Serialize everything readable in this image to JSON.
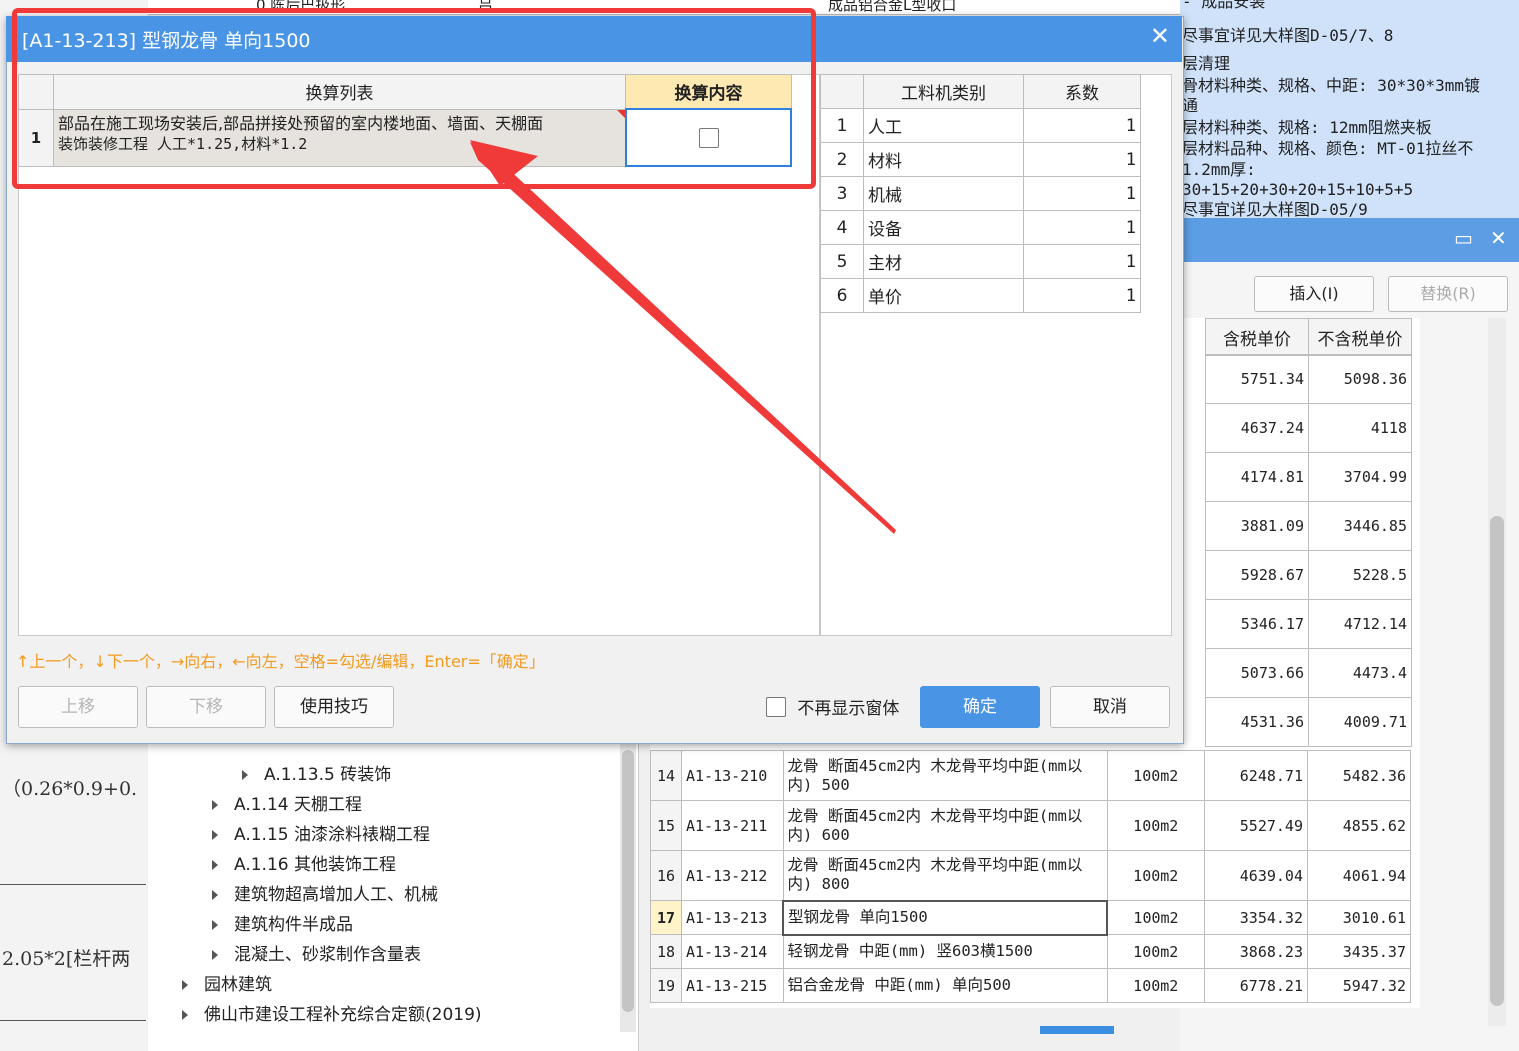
{
  "background": {
    "left_fragments": [
      "（0.26*0.9+0.",
      "2.05*2[栏杆两"
    ],
    "top_strip": [
      "成品铝合金L型收口",
      "吕",
      "0 陈后巴扱形"
    ],
    "description_lines": [
      "- 成品安装",
      "尽事宜详见大样图D-05/7、8",
      "层清理",
      "骨材料种类、规格、中距: 30*30*3mm镀",
      "通",
      "层材料种类、规格: 12mm阻燃夹板",
      "层材料品种、规格、颜色: MT-01拉丝不",
      "1.2mm厚:",
      "30+15+20+30+20+15+10+5+5",
      "尽事宜详见大样图D-05/9"
    ],
    "panel_buttons": {
      "insert": "插入(I)",
      "replace": "替换(R)"
    },
    "price_headers": [
      "含税单价",
      "不含税单价"
    ],
    "price_rows": [
      [
        "5751.34",
        "5098.36"
      ],
      [
        "4637.24",
        "4118"
      ],
      [
        "4174.81",
        "3704.99"
      ],
      [
        "3881.09",
        "3446.85"
      ],
      [
        "5928.67",
        "5228.5"
      ],
      [
        "5346.17",
        "4712.14"
      ],
      [
        "5073.66",
        "4473.4"
      ],
      [
        "4531.36",
        "4009.71"
      ]
    ],
    "quota_rows": [
      {
        "no": "14",
        "code": "A1-13-210",
        "name": "龙骨 断面45cm2内 木龙骨平均中距(mm以内) 500",
        "unit": "100m2",
        "tax": "6248.71",
        "notax": "5482.36"
      },
      {
        "no": "15",
        "code": "A1-13-211",
        "name": "龙骨 断面45cm2内 木龙骨平均中距(mm以内) 600",
        "unit": "100m2",
        "tax": "5527.49",
        "notax": "4855.62"
      },
      {
        "no": "16",
        "code": "A1-13-212",
        "name": "龙骨 断面45cm2内 木龙骨平均中距(mm以内) 800",
        "unit": "100m2",
        "tax": "4639.04",
        "notax": "4061.94"
      },
      {
        "no": "17",
        "code": "A1-13-213",
        "name": "型钢龙骨 单向1500",
        "unit": "100m2",
        "tax": "3354.32",
        "notax": "3010.61"
      },
      {
        "no": "18",
        "code": "A1-13-214",
        "name": "轻钢龙骨 中距(mm) 竖603横1500",
        "unit": "100m2",
        "tax": "3868.23",
        "notax": "3435.37"
      },
      {
        "no": "19",
        "code": "A1-13-215",
        "name": "铝合金龙骨 中距(mm) 单向500",
        "unit": "100m2",
        "tax": "6778.21",
        "notax": "5947.32"
      }
    ],
    "tree": [
      {
        "label": "A.1.13.5 砖装饰",
        "level": 3
      },
      {
        "label": "A.1.14 天棚工程",
        "level": 2
      },
      {
        "label": "A.1.15 油漆涂料裱糊工程",
        "level": 2
      },
      {
        "label": "A.1.16 其他装饰工程",
        "level": 2
      },
      {
        "label": "建筑物超高增加人工、机械",
        "level": 2
      },
      {
        "label": "建筑构件半成品",
        "level": 2
      },
      {
        "label": "混凝土、砂浆制作含量表",
        "level": 2
      },
      {
        "label": "园林建筑",
        "level": 1
      },
      {
        "label": "佛山市建设工程补充综合定额(2019)",
        "level": 1
      }
    ]
  },
  "dialog": {
    "title": "[A1-13-213] 型钢龙骨 单向1500",
    "conversion_headers": {
      "list": "换算列表",
      "content": "换算内容"
    },
    "conversion_rows": [
      {
        "no": "1",
        "text_line1": "部品在施工现场安装后,部品拼接处预留的室内楼地面、墙面、天棚面",
        "text_line2": "装饰装修工程 人工*1.25,材料*1.2",
        "checked": false
      }
    ],
    "coef_headers": {
      "category": "工料机类别",
      "factor": "系数"
    },
    "coef_rows": [
      {
        "no": "1",
        "category": "人工",
        "factor": "1"
      },
      {
        "no": "2",
        "category": "材料",
        "factor": "1"
      },
      {
        "no": "3",
        "category": "机械",
        "factor": "1"
      },
      {
        "no": "4",
        "category": "设备",
        "factor": "1"
      },
      {
        "no": "5",
        "category": "主材",
        "factor": "1"
      },
      {
        "no": "6",
        "category": "单价",
        "factor": "1"
      }
    ],
    "hint": "↑上一个，↓下一个，→向右，←向左，空格=勾选/编辑，Enter=「确定」",
    "buttons": {
      "up": "上移",
      "down": "下移",
      "tips": "使用技巧",
      "ok": "确定",
      "cancel": "取消"
    },
    "no_show_label": "不再显示窗体"
  },
  "colors": {
    "title_bar": "#4a94e6",
    "annotation": "#f03a3a",
    "hint": "#f39a1f"
  }
}
